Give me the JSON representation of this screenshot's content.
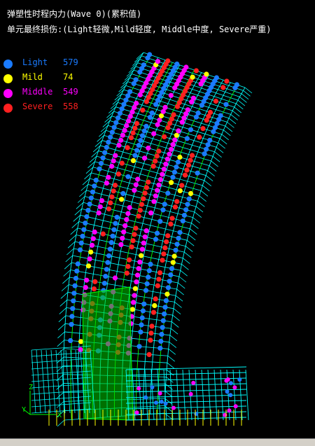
{
  "title_line1": "弹塑性时程内力(Wave 0)(累积值)",
  "title_line2": "单元最终损伤:(Light轻微,Mild轻度, Middle中度, Severe严重)",
  "legend": [
    {
      "label": "Light",
      "count": "579",
      "color": "#1a7bff"
    },
    {
      "label": "Mild",
      "count": "74",
      "color": "#ffff00"
    },
    {
      "label": "Middle",
      "count": "549",
      "color": "#ff00ff"
    },
    {
      "label": "Severe",
      "count": "558",
      "color": "#ff2020"
    }
  ],
  "axes": {
    "z": "Z",
    "y": "Y",
    "x": "X"
  },
  "colors": {
    "background": "#000000",
    "frame_cyan": "#00ffff",
    "frame_green": "#00ff00",
    "frame_yellow": "#ffff00",
    "frame_white": "#ffffff"
  }
}
